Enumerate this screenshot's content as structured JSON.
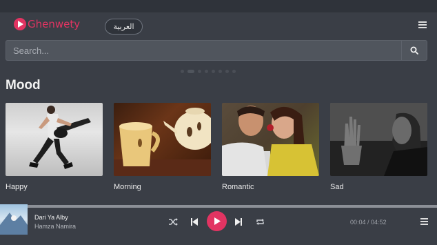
{
  "header": {
    "logo_text": "Ghenwety",
    "language_button": "العربية"
  },
  "search": {
    "placeholder": "Search..."
  },
  "carousel": {
    "dot_count": 8,
    "active_index": 1
  },
  "mood": {
    "title": "Mood",
    "cards": [
      {
        "label": "Happy"
      },
      {
        "label": "Morning"
      },
      {
        "label": "Romantic"
      },
      {
        "label": "Sad"
      }
    ]
  },
  "player": {
    "track_title": "Dari Ya Alby",
    "artist": "Hamza Namira",
    "current_time": "00:04",
    "separator": " / ",
    "duration": "04:52",
    "progress": 0.014
  },
  "colors": {
    "accent": "#e23462",
    "background": "#3a3e46"
  },
  "icons": {
    "menu": "hamburger-menu-icon",
    "search": "search-icon",
    "shuffle": "shuffle-icon",
    "previous": "skip-previous-icon",
    "play": "play-icon",
    "next": "skip-next-icon",
    "repeat": "repeat-icon",
    "queue": "queue-list-icon"
  }
}
